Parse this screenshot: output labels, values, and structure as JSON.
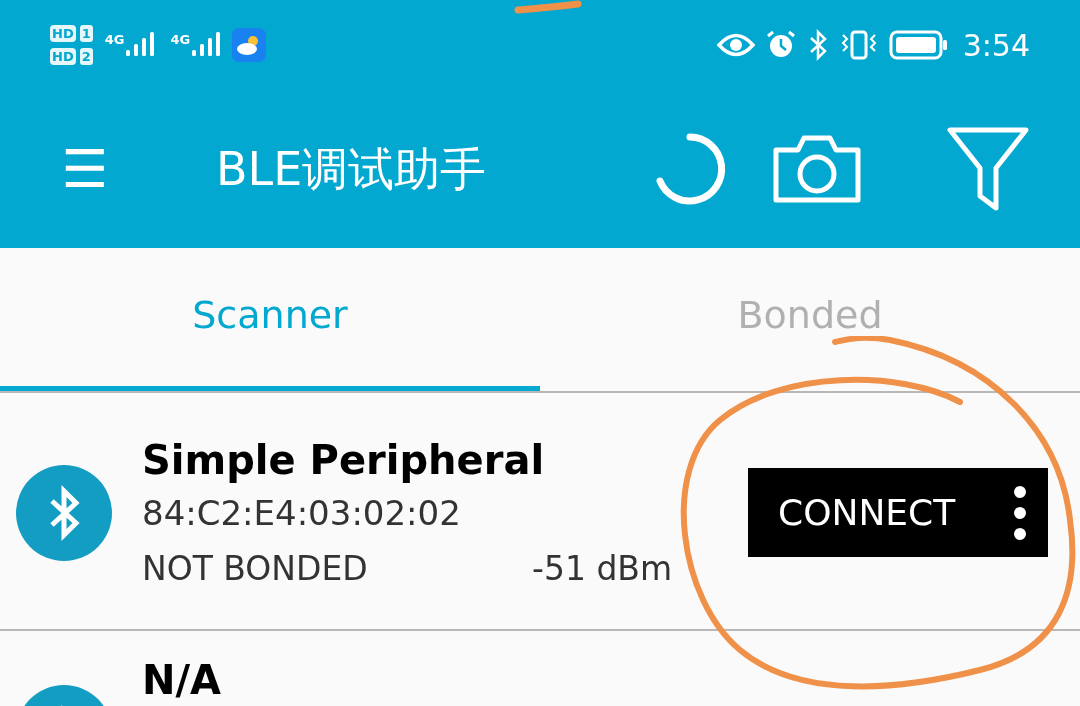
{
  "status_bar": {
    "sims": [
      {
        "badge": "HD",
        "slot": "1"
      },
      {
        "badge": "HD",
        "slot": "2"
      }
    ],
    "networks": [
      {
        "label": "4G"
      },
      {
        "label": "4G"
      }
    ],
    "time": "3:54"
  },
  "app_bar": {
    "menu_glyph": "☰",
    "title": "BLE调试助手"
  },
  "tabs": [
    {
      "label": "Scanner",
      "selected": true
    },
    {
      "label": "Bonded",
      "selected": false
    }
  ],
  "devices": [
    {
      "name": "Simple Peripheral",
      "address": "84:C2:E4:03:02:02",
      "bond_state": "NOT BONDED",
      "rssi": "-51 dBm",
      "action": "CONNECT"
    },
    {
      "name": "N/A"
    }
  ]
}
